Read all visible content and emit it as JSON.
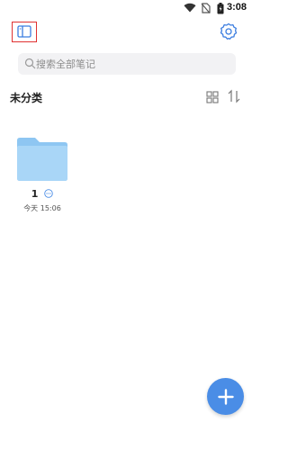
{
  "status_bar": {
    "time": "3:08",
    "icons": [
      "wifi-icon",
      "no-sim-icon",
      "battery-icon"
    ]
  },
  "top_bar": {
    "left_icon": "sidebar-toggle-icon",
    "right_icon": "gear-icon",
    "highlight_color": "#e03131",
    "accent_color": "#4a8de6"
  },
  "search": {
    "placeholder": "搜索全部笔记"
  },
  "section": {
    "title": "未分类",
    "icons": [
      "grid-view-icon",
      "sort-icon"
    ]
  },
  "folders": [
    {
      "name": "1",
      "time": "今天 15:06",
      "icon": "folder-icon",
      "color": "#a4d3f6"
    }
  ],
  "fab": {
    "icon": "plus-icon",
    "color": "#4a8de6"
  }
}
